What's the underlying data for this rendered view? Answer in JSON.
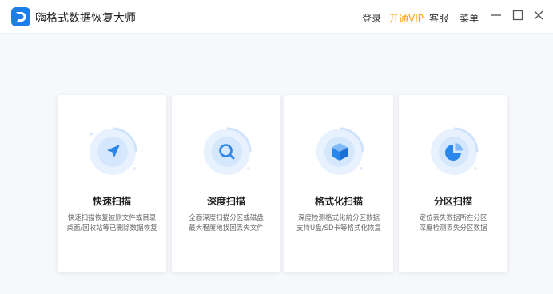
{
  "app": {
    "title": "嗨格式数据恢复大师",
    "logo_icon": "app-logo-icon",
    "brand_color": "#1f7de8"
  },
  "header": {
    "login": "登录",
    "vip": "开通VIP",
    "vip_color": "#f5a316",
    "service": "客服",
    "menu": "菜单",
    "window_controls": [
      "minimize-icon",
      "maximize-icon",
      "close-icon"
    ]
  },
  "cards": [
    {
      "title": "快速扫描",
      "desc_line1": "快速扫描恢复被删文件或目录",
      "desc_line2": "桌面/回收站等已删除数据恢复",
      "icon": "navigation-arrow-icon"
    },
    {
      "title": "深度扫描",
      "desc_line1": "全面深度扫描分区或磁盘",
      "desc_line2": "最大程度地找回丢失文件",
      "icon": "magnifier-icon"
    },
    {
      "title": "格式化扫描",
      "desc_line1": "深度检测格式化前分区数据",
      "desc_line2": "支持U盘/SD卡等格式化恢复",
      "icon": "cube-icon"
    },
    {
      "title": "分区扫描",
      "desc_line1": "定位丢失数据所在分区",
      "desc_line2": "深度检测丢失分区数据",
      "icon": "pie-chart-icon"
    }
  ]
}
